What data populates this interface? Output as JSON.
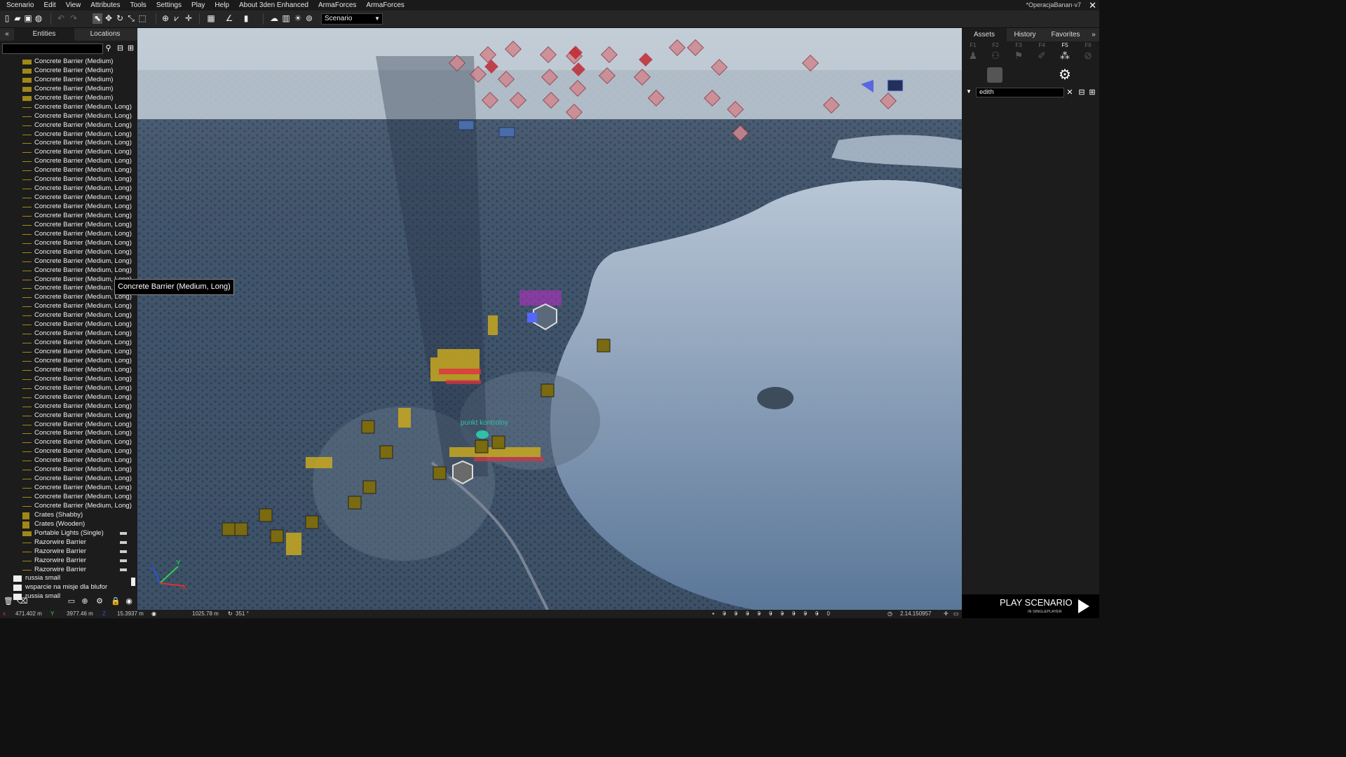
{
  "menu": [
    "Scenario",
    "Edit",
    "View",
    "Attributes",
    "Tools",
    "Settings",
    "Play",
    "Help",
    "About 3den Enhanced",
    "ArmaForces",
    "ArmaForces"
  ],
  "title": "*OperacjaBanan·v7",
  "toolbar": {
    "scenario_combo": "Scenario"
  },
  "left_panel": {
    "tab_entities": "Entities",
    "tab_locations": "Locations",
    "collapse": "«",
    "rows": [
      {
        "label": "Concrete Barrier (Medium)",
        "kind": "block"
      },
      {
        "label": "Concrete Barrier (Medium)",
        "kind": "block"
      },
      {
        "label": "Concrete Barrier (Medium)",
        "kind": "block"
      },
      {
        "label": "Concrete Barrier (Medium)",
        "kind": "block"
      },
      {
        "label": "Concrete Barrier (Medium)",
        "kind": "block"
      },
      {
        "label": "Concrete Barrier (Medium, Long)",
        "kind": "line"
      },
      {
        "label": "Concrete Barrier (Medium, Long)",
        "kind": "line"
      },
      {
        "label": "Concrete Barrier (Medium, Long)",
        "kind": "line"
      },
      {
        "label": "Concrete Barrier (Medium, Long)",
        "kind": "line"
      },
      {
        "label": "Concrete Barrier (Medium, Long)",
        "kind": "line"
      },
      {
        "label": "Concrete Barrier (Medium, Long)",
        "kind": "line"
      },
      {
        "label": "Concrete Barrier (Medium, Long)",
        "kind": "line"
      },
      {
        "label": "Concrete Barrier (Medium, Long)",
        "kind": "line"
      },
      {
        "label": "Concrete Barrier (Medium, Long)",
        "kind": "line"
      },
      {
        "label": "Concrete Barrier (Medium, Long)",
        "kind": "line"
      },
      {
        "label": "Concrete Barrier (Medium, Long)",
        "kind": "line"
      },
      {
        "label": "Concrete Barrier (Medium, Long)",
        "kind": "line"
      },
      {
        "label": "Concrete Barrier (Medium, Long)",
        "kind": "line"
      },
      {
        "label": "Concrete Barrier (Medium, Long)",
        "kind": "line"
      },
      {
        "label": "Concrete Barrier (Medium, Long)",
        "kind": "line"
      },
      {
        "label": "Concrete Barrier (Medium, Long)",
        "kind": "line"
      },
      {
        "label": "Concrete Barrier (Medium, Long)",
        "kind": "line"
      },
      {
        "label": "Concrete Barrier (Medium, Long)",
        "kind": "line"
      },
      {
        "label": "Concrete Barrier (Medium, Long)",
        "kind": "line"
      },
      {
        "label": "Concrete Barrier (Medium, Long)",
        "kind": "line"
      },
      {
        "label": "Concrete Barrier (Medium, Long)",
        "kind": "line"
      },
      {
        "label": "Concrete Barrier (Medium, Long)",
        "kind": "line"
      },
      {
        "label": "Concrete Barrier (Medium, Long)",
        "kind": "line"
      },
      {
        "label": "Concrete Barrier (Medium, Long)",
        "kind": "line"
      },
      {
        "label": "Concrete Barrier (Medium, Long)",
        "kind": "line"
      },
      {
        "label": "Concrete Barrier (Medium, Long)",
        "kind": "line"
      },
      {
        "label": "Concrete Barrier (Medium, Long)",
        "kind": "line"
      },
      {
        "label": "Concrete Barrier (Medium, Long)",
        "kind": "line"
      },
      {
        "label": "Concrete Barrier (Medium, Long)",
        "kind": "line"
      },
      {
        "label": "Concrete Barrier (Medium, Long)",
        "kind": "line"
      },
      {
        "label": "Concrete Barrier (Medium, Long)",
        "kind": "line"
      },
      {
        "label": "Concrete Barrier (Medium, Long)",
        "kind": "line"
      },
      {
        "label": "Concrete Barrier (Medium, Long)",
        "kind": "line"
      },
      {
        "label": "Concrete Barrier (Medium, Long)",
        "kind": "line"
      },
      {
        "label": "Concrete Barrier (Medium, Long)",
        "kind": "line"
      },
      {
        "label": "Concrete Barrier (Medium, Long)",
        "kind": "line"
      },
      {
        "label": "Concrete Barrier (Medium, Long)",
        "kind": "line"
      },
      {
        "label": "Concrete Barrier (Medium, Long)",
        "kind": "line"
      },
      {
        "label": "Concrete Barrier (Medium, Long)",
        "kind": "line"
      },
      {
        "label": "Concrete Barrier (Medium, Long)",
        "kind": "line"
      },
      {
        "label": "Concrete Barrier (Medium, Long)",
        "kind": "line"
      },
      {
        "label": "Concrete Barrier (Medium, Long)",
        "kind": "line"
      },
      {
        "label": "Concrete Barrier (Medium, Long)",
        "kind": "line"
      },
      {
        "label": "Concrete Barrier (Medium, Long)",
        "kind": "line"
      },
      {
        "label": "Concrete Barrier (Medium, Long)",
        "kind": "line"
      },
      {
        "label": "Crates (Shabby)",
        "kind": "crate"
      },
      {
        "label": "Crates (Wooden)",
        "kind": "crate"
      },
      {
        "label": "Portable Lights (Single)",
        "kind": "block",
        "tag": true
      },
      {
        "label": "Razorwire Barrier",
        "kind": "line",
        "tag": true
      },
      {
        "label": "Razorwire Barrier",
        "kind": "line",
        "tag": true
      },
      {
        "label": "Razorwire Barrier",
        "kind": "line",
        "tag": true
      },
      {
        "label": "Razorwire Barrier",
        "kind": "line",
        "tag": true
      },
      {
        "label": "russia small",
        "kind": "folder"
      },
      {
        "label": "wsparcie na misje dla blufor",
        "kind": "folder"
      },
      {
        "label": "russia small",
        "kind": "folder"
      }
    ]
  },
  "tooltip": "Concrete Barrier (Medium, Long)",
  "map_label": "punkt kontrolny",
  "axes": {
    "z": "Z",
    "y": "Y",
    "x": "X"
  },
  "right_panel": {
    "tab_assets": "Assets",
    "tab_history": "History",
    "tab_favorites": "Favorites",
    "expand": "»",
    "fkeys": [
      "F1",
      "F2",
      "F3",
      "F4",
      "F5",
      "F6"
    ],
    "search_value": "edith"
  },
  "play": {
    "title": "PLAY SCENARIO",
    "subtitle": "IN SINGLEPLAYER"
  },
  "status": {
    "x": "471.402 m",
    "y": "3977.46 m",
    "z": "15.3937 m",
    "distance": "1025.78 m",
    "rotation": "351 °",
    "counts": [
      "0",
      "0",
      "0",
      "0",
      "0",
      "0",
      "0",
      "0",
      "0",
      "0"
    ],
    "time": "2.14.150957"
  },
  "colors": {
    "accent_red": "#c0202a",
    "crate_yellow": "#a08818",
    "marker_blue": "#3a50c0",
    "teal": "#30c0a8"
  }
}
